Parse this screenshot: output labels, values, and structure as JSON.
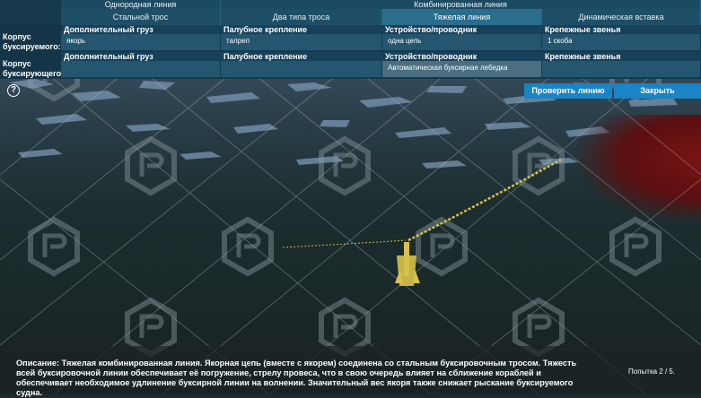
{
  "header": {
    "group_single": "Однородная линия",
    "group_combined": "Комбинированная линия",
    "tabs": [
      {
        "label": "Стальной трос",
        "active": false
      },
      {
        "label": "Два типа троса",
        "active": false
      },
      {
        "label": "Тяжелая линия",
        "active": true
      },
      {
        "label": "Динамическая вставка",
        "active": false
      }
    ]
  },
  "rows": [
    {
      "label": "Корпус буксируемого:",
      "fields": [
        {
          "title": "Дополнительный груз",
          "value": "якорь"
        },
        {
          "title": "Палубное крепление",
          "value": "талреп"
        },
        {
          "title": "Устройство/проводник",
          "value": "одна цепь"
        },
        {
          "title": "Крепежные звенья",
          "value": "1 скоба"
        }
      ]
    },
    {
      "label": "Корпус буксирующего:",
      "fields": [
        {
          "title": "Дополнительный груз",
          "value": ""
        },
        {
          "title": "Палубное крепление",
          "value": ""
        },
        {
          "title": "Устройство/проводник",
          "value": "Автоматическая буксирная лебедка"
        },
        {
          "title": "Крепежные звенья",
          "value": ""
        }
      ]
    }
  ],
  "help_symbol": "?",
  "buttons": {
    "check": "Проверить линию",
    "close": "Закрыть"
  },
  "description": "Описание: Тяжелая комбинированная линия. Якорная цепь (вместе с якорем) соединена со стальным буксировочным тросом. Тяжесть всей буксировочной линии обеспечивает её погружение, стрелу провеса, что в свою очередь влияет на сближение кораблей и обеспечивает необходимое удлинение буксирной линии на волнении. Значительный вес якоря также снижает рыскание буксируемого судна.",
  "attempt": "Попытка 2 / 5.",
  "colors": {
    "accent_button": "#1a84c4",
    "header_bg": "#163a4c",
    "active_tab": "#2a6d8c",
    "chain": "#d8c24a",
    "hull": "#7a1414"
  }
}
